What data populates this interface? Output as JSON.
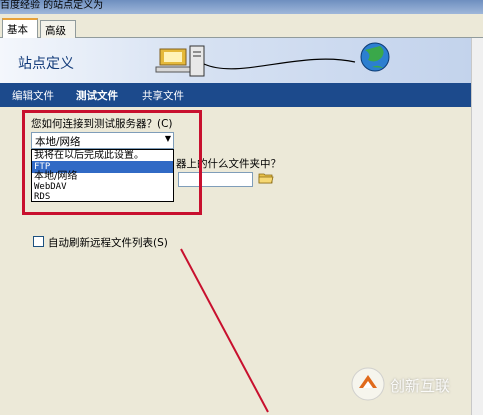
{
  "window": {
    "title": "百度经验 的站点定义为"
  },
  "tabs": [
    {
      "label": "基本",
      "active": true
    },
    {
      "label": "高级",
      "active": false
    }
  ],
  "banner": {
    "title": "站点定义"
  },
  "nav": [
    {
      "label": "编辑文件",
      "active": false
    },
    {
      "label": "测试文件",
      "active": true
    },
    {
      "label": "共享文件",
      "active": false
    }
  ],
  "form": {
    "connect_question": "您如何连接到测试服务器？(C)",
    "connect_selected": "本地/网络",
    "connect_options": [
      {
        "label": "我将在以后完成此设置。",
        "selected": false
      },
      {
        "label": "FTP",
        "selected": true
      },
      {
        "label": "本地/网络",
        "selected": false
      },
      {
        "label": "WebDAV",
        "selected": false
      },
      {
        "label": "RDS",
        "selected": false
      }
    ],
    "folder_question_tail": "器上的什么文件夹中？",
    "auto_refresh_label": "自动刷新远程文件列表(S)",
    "auto_refresh_checked": false
  },
  "watermark": {
    "text": "创新互联"
  },
  "colors": {
    "nav_bg": "#1c4a8c",
    "highlight": "#c8102e",
    "selected": "#316ac5"
  }
}
